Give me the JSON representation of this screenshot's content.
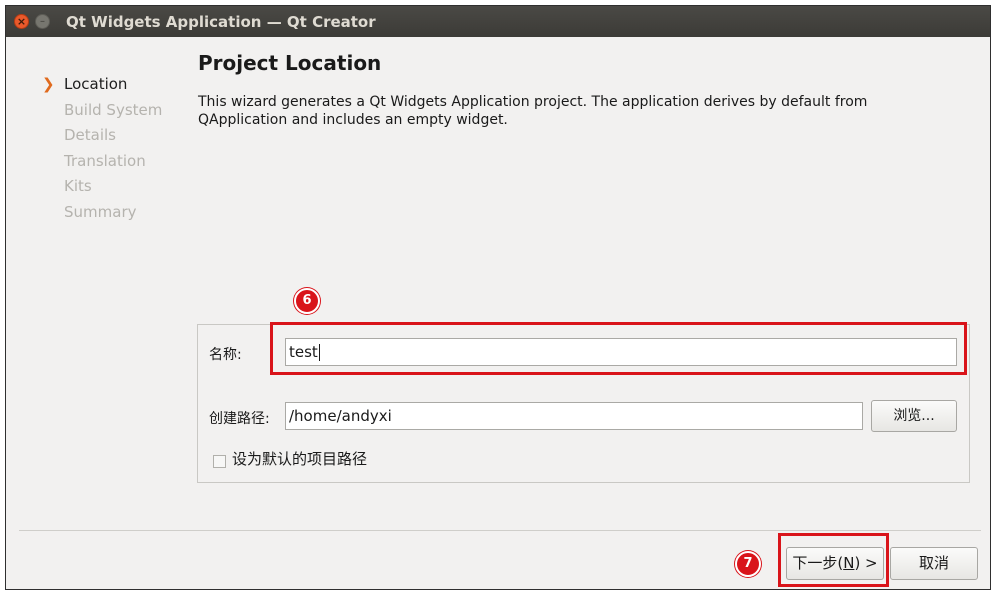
{
  "window": {
    "title": "Qt Widgets Application — Qt Creator"
  },
  "sidebar": {
    "items": [
      {
        "label": "Location",
        "active": true
      },
      {
        "label": "Build System",
        "active": false
      },
      {
        "label": "Details",
        "active": false
      },
      {
        "label": "Translation",
        "active": false
      },
      {
        "label": "Kits",
        "active": false
      },
      {
        "label": "Summary",
        "active": false
      }
    ]
  },
  "page": {
    "title": "Project Location",
    "description": "This wizard generates a Qt Widgets Application project. The application derives by default from QApplication and includes an empty widget."
  },
  "form": {
    "name_label": "名称:",
    "name_value": "test",
    "path_label": "创建路径:",
    "path_value": "/home/andyxi",
    "browse_label": "浏览...",
    "default_checkbox_label": "设为默认的项目路径",
    "default_checkbox_checked": false
  },
  "footer": {
    "next_prefix": "下一步(",
    "next_mnemonic": "N",
    "next_suffix": ") >",
    "cancel_label": "取消"
  },
  "annotations": {
    "marker_6": "6",
    "marker_7": "7",
    "highlight_color": "#d9141a"
  },
  "colors": {
    "accent_arrow": "#e06a1d",
    "titlebar": "#3c3b37"
  }
}
